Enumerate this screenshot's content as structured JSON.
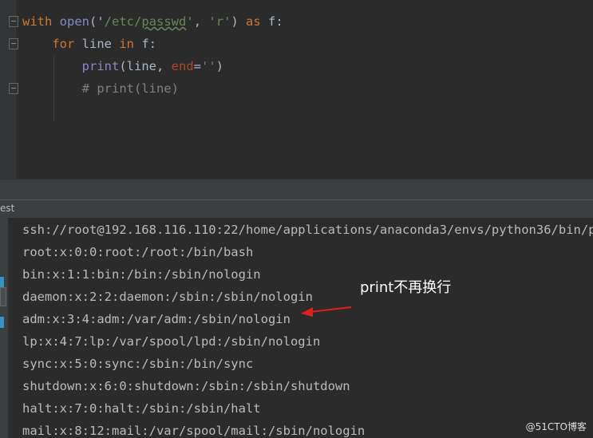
{
  "editor": {
    "lines": [
      [
        {
          "t": "with ",
          "c": "kw"
        },
        {
          "t": "open",
          "c": "fn"
        },
        {
          "t": "('",
          "c": ""
        },
        {
          "t": "/etc/",
          "c": "str"
        },
        {
          "t": "passwd",
          "c": "str squig"
        },
        {
          "t": "'",
          "c": "str"
        },
        {
          "t": ", ",
          "c": ""
        },
        {
          "t": "'r'",
          "c": "str"
        },
        {
          "t": ") ",
          "c": ""
        },
        {
          "t": "as ",
          "c": "kw"
        },
        {
          "t": "f:",
          "c": ""
        }
      ],
      [
        {
          "t": "    for ",
          "c": "kw"
        },
        {
          "t": "line ",
          "c": ""
        },
        {
          "t": "in ",
          "c": "kw"
        },
        {
          "t": "f:",
          "c": ""
        }
      ],
      [
        {
          "t": "        ",
          "c": ""
        },
        {
          "t": "print",
          "c": "fn"
        },
        {
          "t": "(line, ",
          "c": ""
        },
        {
          "t": "end",
          "c": "par"
        },
        {
          "t": "=",
          "c": ""
        },
        {
          "t": "''",
          "c": "str"
        },
        {
          "t": ")",
          "c": ""
        }
      ],
      [
        {
          "t": "        # print(line)",
          "c": "cm"
        }
      ]
    ]
  },
  "run_panel": {
    "tab_label": "est"
  },
  "console": {
    "lines": [
      "ssh://root@192.168.116.110:22/home/applications/anaconda3/envs/python36/bin/p",
      "root:x:0:0:root:/root:/bin/bash",
      "bin:x:1:1:bin:/bin:/sbin/nologin",
      "daemon:x:2:2:daemon:/sbin:/sbin/nologin",
      "adm:x:3:4:adm:/var/adm:/sbin/nologin",
      "lp:x:4:7:lp:/var/spool/lpd:/sbin/nologin",
      "sync:x:5:0:sync:/sbin:/bin/sync",
      "shutdown:x:6:0:shutdown:/sbin:/sbin/shutdown",
      "halt:x:7:0:halt:/sbin:/sbin/halt",
      "mail:x:8:12:mail:/var/spool/mail:/sbin/nologin"
    ]
  },
  "annotation": {
    "text": "print不再换行",
    "arrow_color": "#e02020"
  },
  "watermark": "@51CTO博客"
}
